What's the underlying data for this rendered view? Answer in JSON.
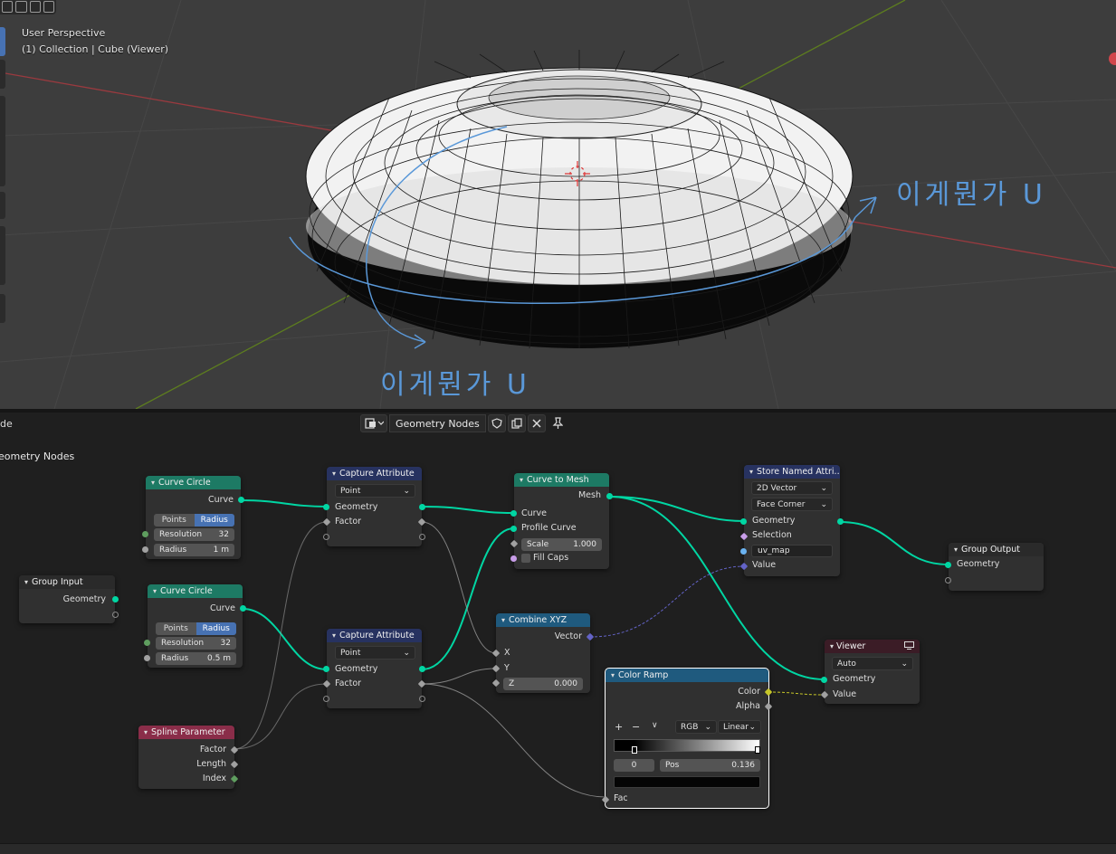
{
  "viewport": {
    "title": "User Perspective",
    "subtitle": "(1) Collection | Cube (Viewer)",
    "annotation_text": "이게뭔가 U"
  },
  "editor_header": {
    "mode_label": "de",
    "tree_name": "Geometry Nodes",
    "breadcrumb": "eometry Nodes"
  },
  "icons": {
    "editor_type": "node-editor-icon",
    "fake_user": "shield-icon",
    "duplicate": "copy-icon",
    "unlink": "close-icon",
    "pin": "pin-icon",
    "viewer_toggle": "monitor-icon"
  },
  "colors": {
    "geometry_socket": "#00d6a3",
    "geometry_header": "#1d7a64",
    "attribute_header": "#273260",
    "converter_header": "#1f5a7e",
    "input_header": "#8a2d49",
    "active_blue": "#4772b3",
    "annotation_blue": "#5a98d8"
  },
  "nodes": {
    "group_input": {
      "title": "Group Input",
      "out_geometry": "Geometry"
    },
    "curve_circle_1": {
      "title": "Curve Circle",
      "out_curve": "Curve",
      "mode_points": "Points",
      "mode_radius": "Radius",
      "resolution_label": "Resolution",
      "resolution": "32",
      "radius_label": "Radius",
      "radius": "1 m"
    },
    "curve_circle_2": {
      "title": "Curve Circle",
      "out_curve": "Curve",
      "mode_points": "Points",
      "mode_radius": "Radius",
      "resolution_label": "Resolution",
      "resolution": "32",
      "radius_label": "Radius",
      "radius": "0.5 m"
    },
    "spline_parameter": {
      "title": "Spline Parameter",
      "factor": "Factor",
      "length": "Length",
      "index": "Index"
    },
    "capture_1": {
      "title": "Capture Attribute",
      "domain": "Point",
      "geometry": "Geometry",
      "factor": "Factor"
    },
    "capture_2": {
      "title": "Capture Attribute",
      "domain": "Point",
      "geometry": "Geometry",
      "factor": "Factor"
    },
    "curve_to_mesh": {
      "title": "Curve to Mesh",
      "out_mesh": "Mesh",
      "curve": "Curve",
      "profile": "Profile Curve",
      "scale_label": "Scale",
      "scale": "1.000",
      "fill_caps": "Fill Caps"
    },
    "combine_xyz": {
      "title": "Combine XYZ",
      "out_vector": "Vector",
      "x": "X",
      "y": "Y",
      "z_label": "Z",
      "z": "0.000"
    },
    "store_named": {
      "title": "Store Named Attri...",
      "data_type": "2D Vector",
      "domain": "Face Corner",
      "geometry": "Geometry",
      "selection": "Selection",
      "name": "uv_map",
      "value": "Value"
    },
    "group_output": {
      "title": "Group Output",
      "geometry": "Geometry"
    },
    "viewer": {
      "title": "Viewer",
      "domain": "Auto",
      "geometry": "Geometry",
      "value": "Value"
    },
    "color_ramp": {
      "title": "Color Ramp",
      "out_color": "Color",
      "out_alpha": "Alpha",
      "add": "+",
      "remove": "−",
      "menu": "∨",
      "color_mode": "RGB",
      "interpolation": "Linear",
      "stop_index": "0",
      "pos_label": "Pos",
      "pos": "0.136",
      "fac": "Fac"
    }
  }
}
